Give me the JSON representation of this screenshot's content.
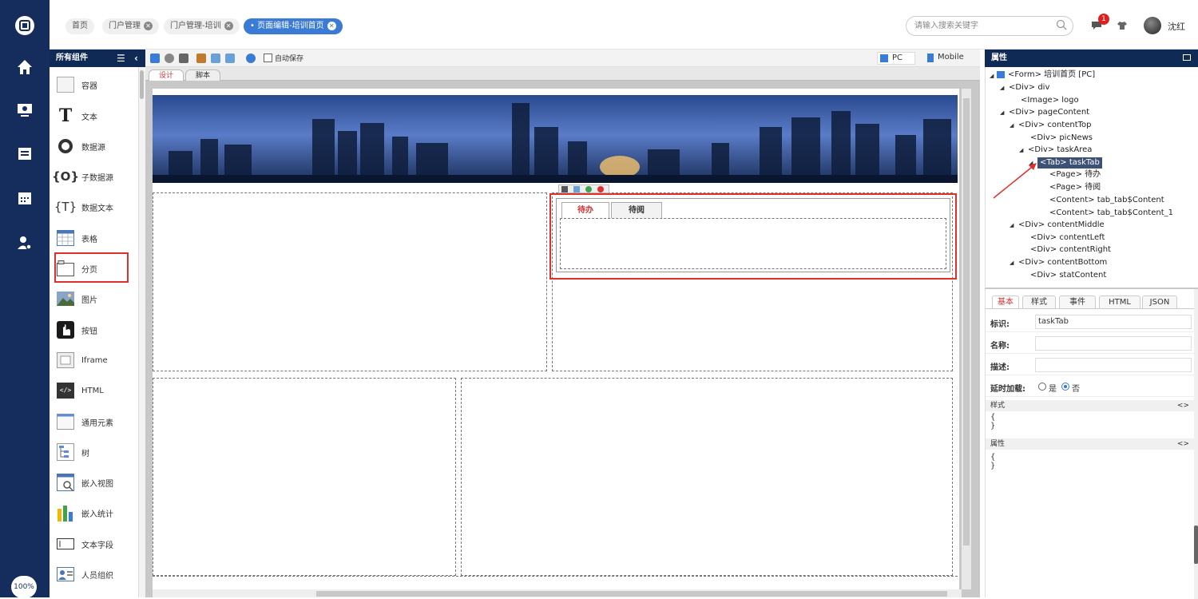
{
  "leftnav": {
    "zoom": "100%"
  },
  "topbar": {
    "tabs": [
      {
        "label": "首页"
      },
      {
        "label": "门户管理"
      },
      {
        "label": "门户管理-培训"
      },
      {
        "label": "页面编辑-培训首页"
      }
    ],
    "search_placeholder": "请输入搜索关键字",
    "notification_count": "1",
    "username": "沈红"
  },
  "components": {
    "header": "所有组件",
    "items": [
      {
        "label": "容器"
      },
      {
        "label": "文本"
      },
      {
        "label": "数据源"
      },
      {
        "label": "子数据源"
      },
      {
        "label": "数据文本"
      },
      {
        "label": "表格"
      },
      {
        "label": "分页"
      },
      {
        "label": "图片"
      },
      {
        "label": "按钮"
      },
      {
        "label": "Iframe"
      },
      {
        "label": "HTML"
      },
      {
        "label": "通用元素"
      },
      {
        "label": "树"
      },
      {
        "label": "嵌入视图"
      },
      {
        "label": "嵌入统计"
      },
      {
        "label": "文本字段"
      },
      {
        "label": "人员组织"
      }
    ]
  },
  "toolbar": {
    "autosave_label": "自动保存",
    "pc_label": "PC",
    "mobile_label": "Mobile"
  },
  "design_tabs": {
    "design": "设计",
    "script": "脚本"
  },
  "canvas": {
    "tab1": "待办",
    "tab2": "待阅",
    "mini_icons": [
      "move-icon",
      "copy-icon",
      "add-icon",
      "remove-icon"
    ]
  },
  "properties": {
    "header": "属性",
    "tree": [
      {
        "text": "<Form> 培训首页 [PC]"
      },
      {
        "text": "<Div> div"
      },
      {
        "text": "<Image> logo"
      },
      {
        "text": "<Div> pageContent"
      },
      {
        "text": "<Div> contentTop"
      },
      {
        "text": "<Div> picNews"
      },
      {
        "text": "<Div> taskArea"
      },
      {
        "text": "<Tab> taskTab"
      },
      {
        "text": "<Page> 待办"
      },
      {
        "text": "<Page> 待阅"
      },
      {
        "text": "<Content> tab_tab$Content"
      },
      {
        "text": "<Content> tab_tab$Content_1"
      },
      {
        "text": "<Div> contentMiddle"
      },
      {
        "text": "<Div> contentLeft"
      },
      {
        "text": "<Div> contentRight"
      },
      {
        "text": "<Div> contentBottom"
      },
      {
        "text": "<Div> statContent"
      }
    ],
    "tabs": [
      "基本",
      "样式",
      "事件",
      "HTML",
      "JSON"
    ],
    "fields": {
      "id_label": "标识:",
      "id_value": "taskTab",
      "name_label": "名称:",
      "name_value": "",
      "desc_label": "描述:",
      "desc_value": "",
      "lazy_label": "延时加载:",
      "lazy_yes": "是",
      "lazy_no": "否"
    },
    "style_section": "样式",
    "attr_section": "属性",
    "brace_open": "{",
    "brace_close": "}",
    "expand_icon": "<>"
  },
  "colors": {
    "nav": "#142d5c",
    "accent": "#3a7bd5",
    "highlight_red": "#e0302e",
    "selected_tree": "#3d5176"
  }
}
